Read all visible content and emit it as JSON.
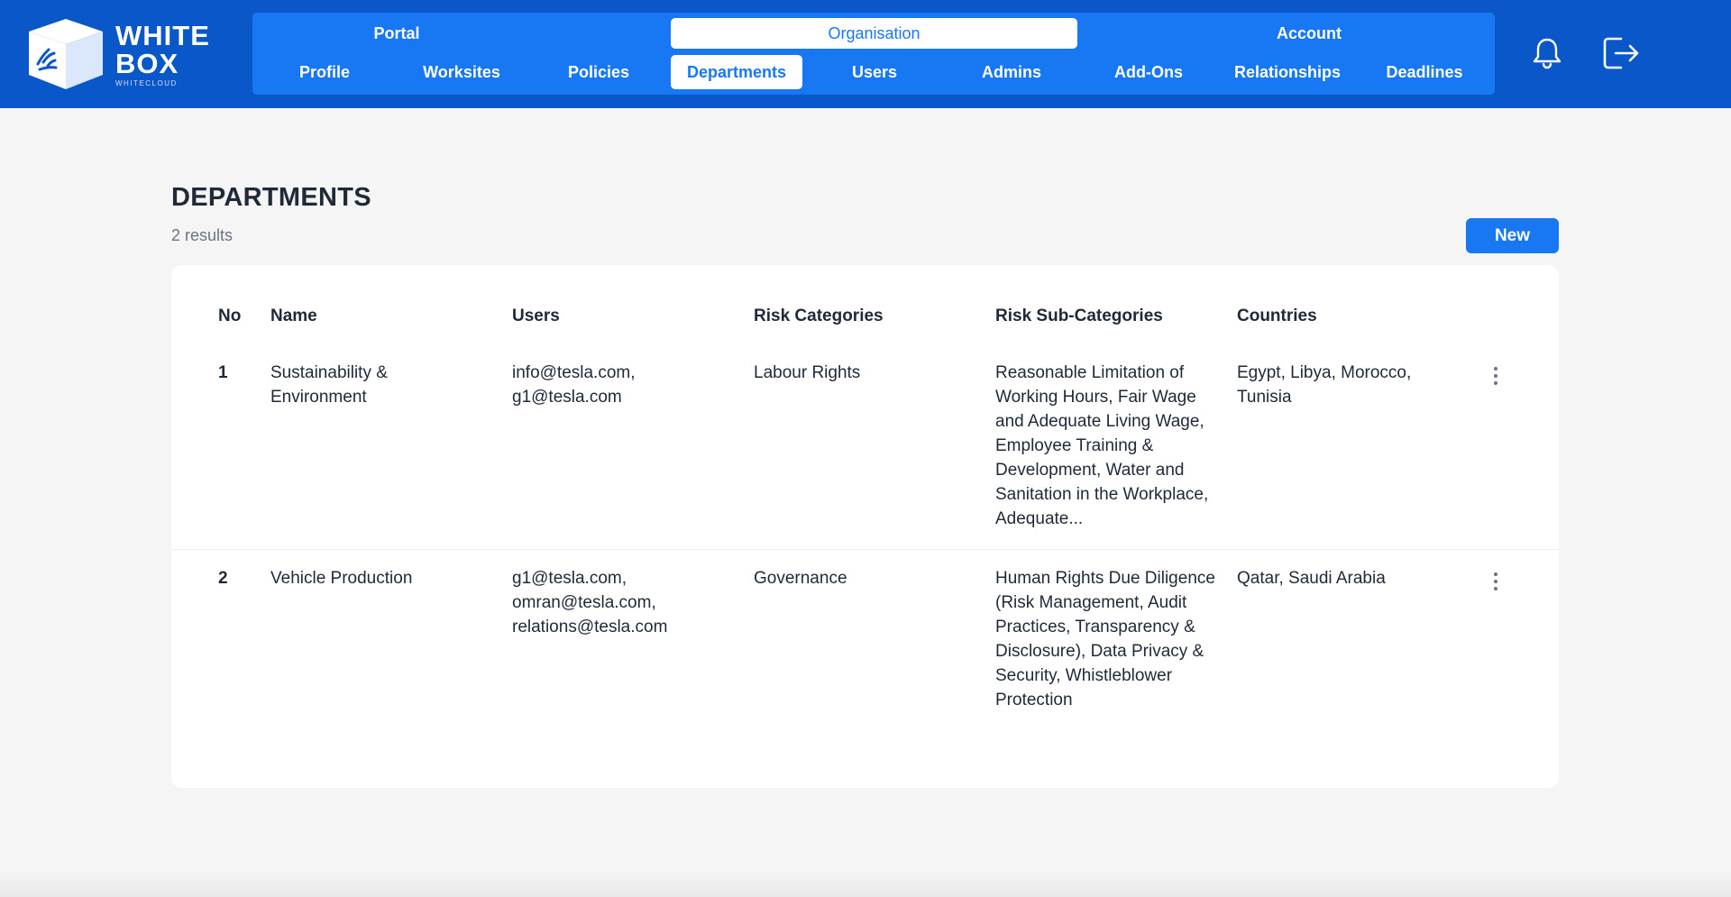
{
  "brand": {
    "line1": "WHITE",
    "line2": "BOX",
    "sub": "WHITECLOUD"
  },
  "nav": {
    "groups": [
      {
        "label": "Portal"
      },
      {
        "label": "Organisation",
        "active": true
      },
      {
        "label": "Account"
      }
    ],
    "items": [
      {
        "label": "Profile"
      },
      {
        "label": "Worksites"
      },
      {
        "label": "Policies"
      },
      {
        "label": "Departments",
        "active": true
      },
      {
        "label": "Users"
      },
      {
        "label": "Admins"
      },
      {
        "label": "Add-Ons"
      },
      {
        "label": "Relationships"
      },
      {
        "label": "Deadlines"
      }
    ]
  },
  "icons": {
    "notifications": "bell-icon",
    "logout": "logout-icon",
    "row_menu": "more-vertical-icon"
  },
  "page": {
    "title": "DEPARTMENTS",
    "results": "2 results",
    "new_button": "New"
  },
  "table": {
    "headers": {
      "no": "No",
      "name": "Name",
      "users": "Users",
      "risk_categories": "Risk Categories",
      "risk_sub_categories": "Risk Sub-Categories",
      "countries": "Countries"
    },
    "rows": [
      {
        "no": "1",
        "name": "Sustainability & Environment",
        "users": "info@tesla.com, g1@tesla.com",
        "risk_categories": "Labour Rights",
        "risk_sub_categories": "Reasonable Limitation of Working Hours, Fair Wage and Adequate Living Wage, Employee Training & Development, Water and Sanitation in the Workplace, Adequate...",
        "countries": "Egypt, Libya, Morocco, Tunisia"
      },
      {
        "no": "2",
        "name": "Vehicle Production",
        "users": "g1@tesla.com, omran@tesla.com, relations@tesla.com",
        "risk_categories": "Governance",
        "risk_sub_categories": "Human Rights Due Diligence (Risk Management, Audit Practices, Transparency & Disclosure), Data Privacy & Security, Whistleblower Protection",
        "countries": "Qatar, Saudi Arabia"
      }
    ]
  },
  "colors": {
    "header": "#0a57c9",
    "nav_panel": "#1877f2",
    "accent": "#1877f2",
    "background": "#f5f5f6"
  }
}
